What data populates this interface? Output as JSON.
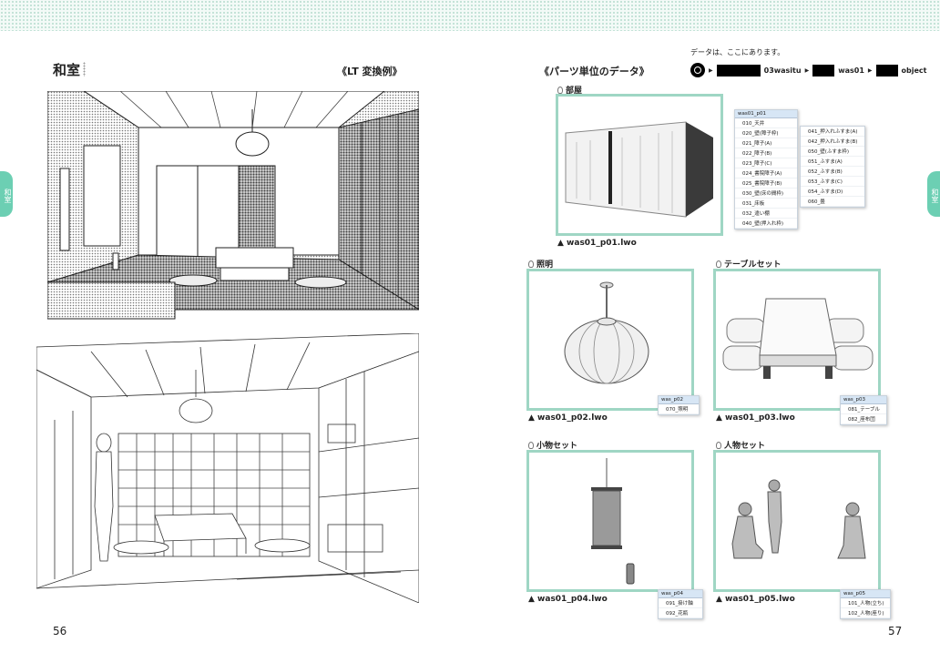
{
  "left_page": {
    "title": "和室",
    "section_label": "《LT 変換例》",
    "side_tab": "和室",
    "page_number": "56"
  },
  "right_page": {
    "section_label": "《パーツ単位のデータ》",
    "side_tab": "和室",
    "page_number": "57",
    "data_location_note": "データは、ここにあります。",
    "path": [
      "03wasitu",
      "was01",
      "object"
    ],
    "parts": [
      {
        "title": "部屋",
        "filename": "▲ was01_p01.lwo",
        "list_header": "was01_p01",
        "items_col1": [
          "010_天井",
          "020_壁(障子枠)",
          "021_障子(A)",
          "022_障子(B)",
          "023_障子(C)",
          "024_書院障子(A)",
          "025_書院障子(B)",
          "030_壁(床の間枠)",
          "031_床板",
          "032_違い棚",
          "040_壁(押入れ枠)"
        ],
        "items_col2": [
          "041_押入れふすま(A)",
          "042_押入れふすま(B)",
          "050_壁(ふすま枠)",
          "051_ふすま(A)",
          "052_ふすま(B)",
          "053_ふすま(C)",
          "054_ふすま(D)",
          "060_畳"
        ]
      },
      {
        "title": "照明",
        "filename": "▲ was01_p02.lwo",
        "list_header": "was_p02",
        "items": [
          "070_照明"
        ]
      },
      {
        "title": "テーブルセット",
        "filename": "▲ was01_p03.lwo",
        "list_header": "was_p03",
        "items": [
          "081_テーブル",
          "082_座布団"
        ]
      },
      {
        "title": "小物セット",
        "filename": "▲ was01_p04.lwo",
        "list_header": "was_p04",
        "items": [
          "091_掛け軸",
          "092_花瓶"
        ]
      },
      {
        "title": "人物セット",
        "filename": "▲ was01_p05.lwo",
        "list_header": "was_p05",
        "items": [
          "101_人物(立ち)",
          "102_人物(座り)"
        ]
      }
    ]
  },
  "colors": {
    "accent": "#6ccfb3",
    "card_border": "#9fd6c4"
  }
}
